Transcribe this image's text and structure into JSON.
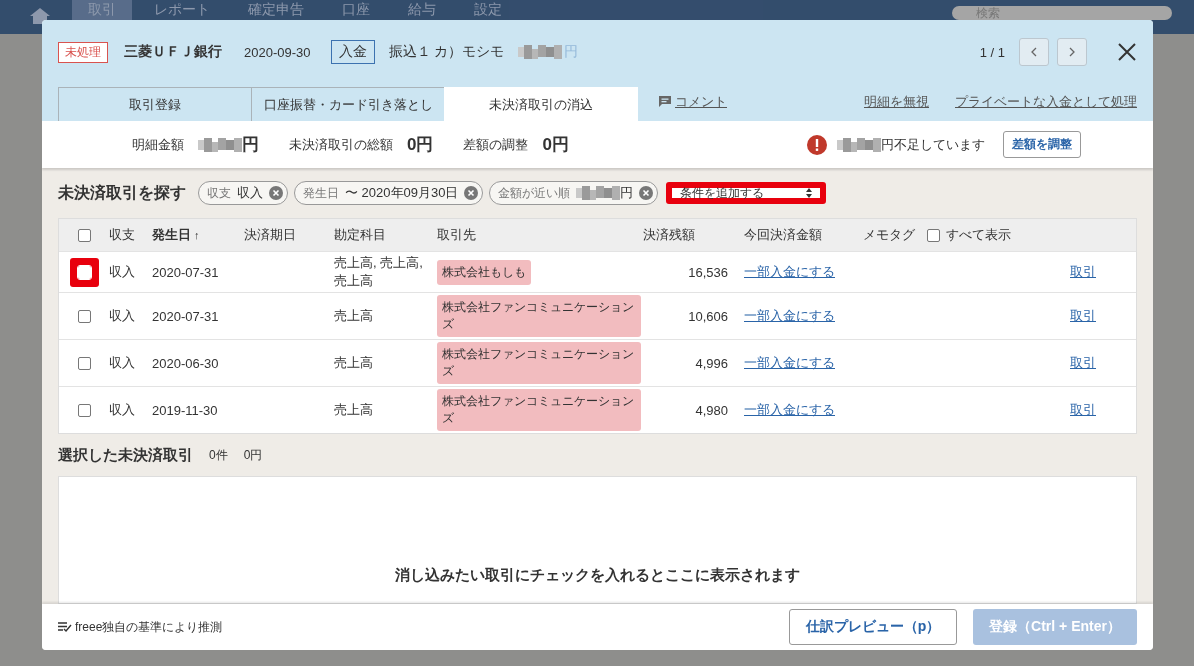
{
  "nav": {
    "items": [
      {
        "label": "取引",
        "selected": true
      },
      {
        "label": "レポート",
        "selected": false
      },
      {
        "label": "確定申告",
        "selected": false
      },
      {
        "label": "口座",
        "selected": false
      },
      {
        "label": "給与",
        "selected": false
      },
      {
        "label": "設定",
        "selected": false
      }
    ],
    "search": {
      "placeholder": "検索"
    }
  },
  "dialog": {
    "status": "未処理",
    "bank": "三菱ＵＦＪ銀行",
    "date": "2020-09-30",
    "direction": "入金",
    "description": "振込１ カ）モシモ",
    "amount": {
      "value": "円",
      "masked": true
    },
    "pager": "1 / 1",
    "tabs": [
      {
        "label": "取引登録",
        "selected": false
      },
      {
        "label": "口座振替・カード引き落とし",
        "selected": false
      },
      {
        "label": "未決済取引の消込",
        "selected": true
      }
    ],
    "comment_link": "コメント",
    "links": [
      "明細を無視",
      "プライベートな入金として処理"
    ],
    "summary": [
      {
        "label": "明細金額",
        "value": "円",
        "masked": true
      },
      {
        "label": "未決済取引の総額",
        "value": "0円",
        "masked": false
      },
      {
        "label": "差額の調整",
        "value": "0円",
        "masked": false
      }
    ],
    "warning": {
      "text": "円不足しています",
      "masked": true,
      "button": "差額を調整"
    },
    "search": {
      "title": "未決済取引を探す",
      "chips": [
        {
          "label": "収支",
          "value": "収入",
          "masked": false
        },
        {
          "label": "発生日",
          "value": "〜 2020年09月30日",
          "masked": false
        },
        {
          "label": "金額が近い順",
          "value": "円",
          "masked": true
        }
      ],
      "select": {
        "value": "条件を追加する",
        "highlighted": true
      }
    },
    "table": {
      "columns": [
        {
          "label": "収支",
          "sorted": false
        },
        {
          "label": "発生日",
          "sorted": true
        },
        {
          "label": "決済期日",
          "sorted": false
        },
        {
          "label": "勘定科目",
          "sorted": false
        },
        {
          "label": "取引先",
          "sorted": false
        },
        {
          "label": "決済残額",
          "sorted": false
        },
        {
          "label": "今回決済金額",
          "sorted": false
        },
        {
          "label": "メモタグ",
          "sorted": false
        }
      ],
      "sort_indicator": "↑",
      "show_all": {
        "label": "すべて表示",
        "checked": false
      },
      "select_all_checked": false,
      "rows": [
        {
          "checked": false,
          "highlighted": true,
          "type": "収入",
          "date": "2020-07-31",
          "account": "売上高, 売上高, 売上高",
          "partner": "株式会社もしも",
          "remaining": "16,536",
          "partial_link": "一部入金にする",
          "detail_link": "取引"
        },
        {
          "checked": false,
          "highlighted": false,
          "type": "収入",
          "date": "2020-07-31",
          "account": "売上高",
          "partner": "株式会社ファンコミュニケーションズ",
          "remaining": "10,606",
          "partial_link": "一部入金にする",
          "detail_link": "取引"
        },
        {
          "checked": false,
          "highlighted": false,
          "type": "収入",
          "date": "2020-06-30",
          "account": "売上高",
          "partner": "株式会社ファンコミュニケーションズ",
          "remaining": "4,996",
          "partial_link": "一部入金にする",
          "detail_link": "取引"
        },
        {
          "checked": false,
          "highlighted": false,
          "type": "収入",
          "date": "2019-11-30",
          "account": "売上高",
          "partner": "株式会社ファンコミュニケーションズ",
          "remaining": "4,980",
          "partial_link": "一部入金にする",
          "detail_link": "取引"
        }
      ]
    },
    "selected_section": {
      "title": "選択した未決済取引",
      "count": "0件",
      "total": "0円",
      "empty_message": "消し込みたい取引にチェックを入れるとここに表示されます"
    },
    "footer": {
      "note": "freee独自の基準により推測",
      "preview_button": "仕訳プレビュー（p）",
      "submit_button": {
        "label": "登録（Ctrl + Enter）",
        "disabled": true
      }
    }
  }
}
